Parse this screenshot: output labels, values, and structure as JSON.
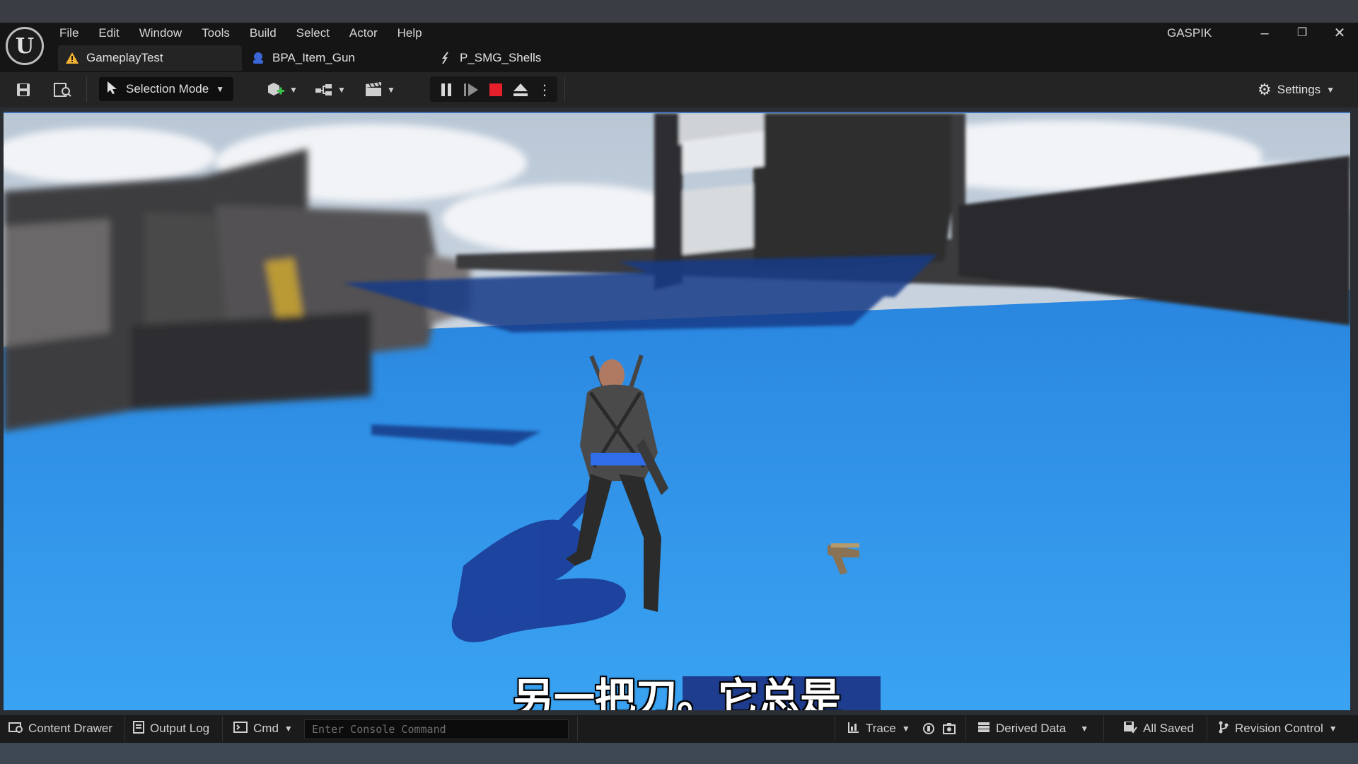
{
  "window": {
    "user": "GASPIK",
    "minimize_icon": "minimize-icon",
    "restore_icon": "restore-icon",
    "close_icon": "close-icon"
  },
  "menu": [
    "File",
    "Edit",
    "Window",
    "Tools",
    "Build",
    "Select",
    "Actor",
    "Help"
  ],
  "tabs": [
    {
      "label": "GameplayTest",
      "icon": "level-warning-icon",
      "active": true
    },
    {
      "label": "BPA_Item_Gun",
      "icon": "blueprint-icon",
      "active": false
    },
    {
      "label": "P_SMG_Shells",
      "icon": "particle-icon",
      "active": false
    }
  ],
  "toolbar": {
    "selection_mode": "Selection Mode",
    "settings": "Settings"
  },
  "viewport": {
    "subtitle": "另一把刀。它总是"
  },
  "statusbar": {
    "content_drawer": "Content Drawer",
    "output_log": "Output Log",
    "cmd": "Cmd",
    "console_placeholder": "Enter Console Command",
    "trace": "Trace",
    "derived_data": "Derived Data",
    "all_saved": "All Saved",
    "revision_control": "Revision Control"
  },
  "colors": {
    "accent": "#3d6fb6",
    "stop_red": "#e5202a",
    "floor_blue": "#2f8fe6"
  }
}
